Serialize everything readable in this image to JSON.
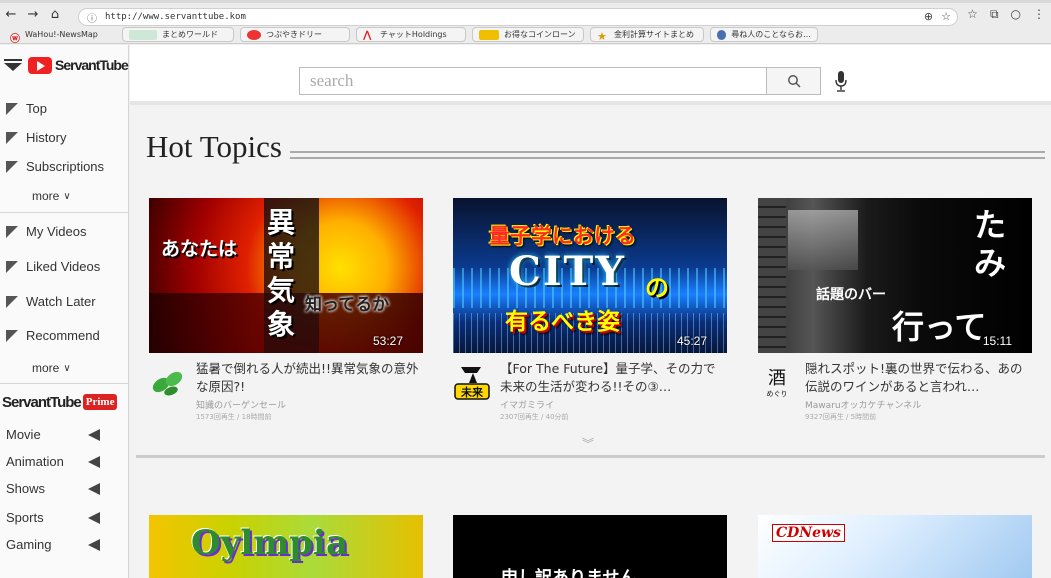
{
  "browser": {
    "url": "http://www.servanttube.kom",
    "bookmarks": [
      "WaHou!-NewsMap",
      "まとめワールド",
      "つぶやきドリー",
      "チャットHoldings",
      "お得なコインローン",
      "金利計算サイトまとめ",
      "尋ね人のことならお…"
    ]
  },
  "logo": {
    "text": "ServantTube"
  },
  "sidebar": {
    "items_top": [
      "Top",
      "History",
      "Subscriptions"
    ],
    "more_top": "more",
    "items_mid": [
      "My Videos",
      "Liked Videos",
      "Watch Later",
      "Recommend"
    ],
    "more_mid": "more",
    "prime_text": "ServantTube",
    "prime_badge": "Prime",
    "categories": [
      "Movie",
      "Animation",
      "Shows",
      "Sports",
      "Gaming"
    ]
  },
  "search": {
    "placeholder": "search"
  },
  "section": {
    "title": "Hot Topics"
  },
  "videos": [
    {
      "thumb_text_left": "あなたは",
      "thumb_text_v": "異常気象",
      "thumb_text_right": "知ってるか",
      "duration": "53:27",
      "title": "猛暑で倒れる人が続出!!異常気象の意外な原因?!",
      "channel": "知識のバーゲンセール",
      "stats": "1573回再生 / 18時間前"
    },
    {
      "thumb_text_top": "量子学における",
      "thumb_text_mid": "CITY",
      "thumb_text_no": "の",
      "thumb_text_bottom": "有るべき姿",
      "duration": "45:27",
      "title": "【For The Future】量子学、その力で未来の生活が変わる!!その③…",
      "channel": "イマガミライ",
      "stats": "2307回再生 / 40分前"
    },
    {
      "thumb_text_a": "たみ",
      "thumb_text_b": "話題のバー",
      "thumb_text_c": "行って",
      "duration": "15:11",
      "title": "隠れスポット!裏の世界で伝わる、あの伝説のワインがあると言われ…",
      "channel": "Mawaruオッカケチャンネル",
      "stats": "9327回再生 / 5時間前"
    }
  ],
  "row2": {
    "thumb1_text": "Oylmpia",
    "thumb2_text": "申し訳ありません",
    "thumb3_text": "CDNews"
  },
  "colors": {
    "accent": "#e22222",
    "prime": "#d22222"
  }
}
